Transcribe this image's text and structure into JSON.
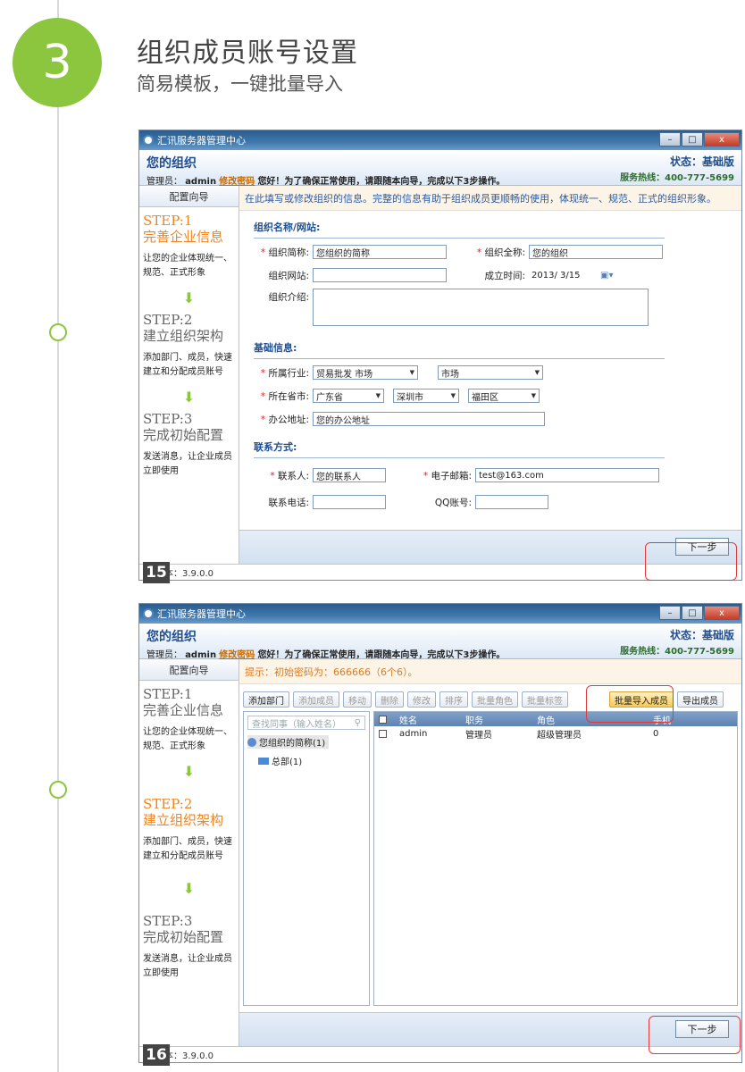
{
  "section": {
    "number": "3",
    "title": "组织成员账号设置",
    "subtitle": "简易模板，一键批量导入"
  },
  "window": {
    "title": "汇讯服务器管理中心",
    "org_name": "您的组织",
    "admin_prefix": "管理员：",
    "admin_user": "admin",
    "change_password": "修改密码",
    "admin_message": "您好！为了确保正常使用，请跟随本向导，完成以下3步操作。",
    "status": "状态：基础版",
    "hotline": "服务热线：400-777-5699",
    "version": "版本：3.9.0.0",
    "next_label": "下一步",
    "buttons": {
      "minimize": "–",
      "maximize": "□",
      "close": "x"
    }
  },
  "sidebar": {
    "header": "配置向导",
    "steps": [
      {
        "title": "STEP:1",
        "subtitle": "完善企业信息",
        "desc": "让您的企业体现统一、规范、正式形象"
      },
      {
        "title": "STEP:2",
        "subtitle": "建立组织架构",
        "desc": "添加部门、成员，快速建立和分配成员账号"
      },
      {
        "title": "STEP:3",
        "subtitle": "完成初始配置",
        "desc": "发送消息，让企业成员立即使用"
      }
    ],
    "arrow": "⬇"
  },
  "screen1": {
    "page_number": "15",
    "notice": "在此填写或修改组织的信息。完整的信息有助于组织成员更顺畅的使用，体现统一、规范、正式的组织形象。",
    "org_section": "组织名称/网站:",
    "short_name_label": "组织简称:",
    "short_name_value": "您组织的简称",
    "full_name_label": "组织全称:",
    "full_name_value": "您的组织",
    "website_label": "组织网站:",
    "website_value": "",
    "founded_label": "成立时间:",
    "founded_value": "2013/ 3/15",
    "intro_label": "组织介绍:",
    "basic_section": "基础信息:",
    "industry_label": "所属行业:",
    "industry_value": "贸易批发 市场",
    "industry_sub_value": "市场",
    "region_label": "所在省市:",
    "province": "广东省",
    "city": "深圳市",
    "district": "福田区",
    "address_label": "办公地址:",
    "address_value": "您的办公地址",
    "contact_section": "联系方式:",
    "contact_label": "联系人:",
    "contact_value": "您的联系人",
    "email_label": "电子邮箱:",
    "email_value": "test@163.com",
    "phone_label": "联系电话:",
    "qq_label": "QQ账号:",
    "req_mark": "*"
  },
  "screen2": {
    "page_number": "16",
    "notice": "提示：初始密码为：666666（6个6）。",
    "toolbar": [
      "添加部门",
      "添加成员",
      "移动",
      "删除",
      "修改",
      "排序",
      "批量角色",
      "批量标签"
    ],
    "import_label": "批量导入成员",
    "export_label": "导出成员",
    "search_placeholder": "查找同事（输入姓名）",
    "tree_root": "您组织的简称(1)",
    "tree_child": "总部(1)",
    "columns": [
      "姓名",
      "职务",
      "角色",
      "手机"
    ],
    "rows": [
      {
        "name": "admin",
        "position": "管理员",
        "role": "超级管理员",
        "phone": "0"
      }
    ]
  }
}
